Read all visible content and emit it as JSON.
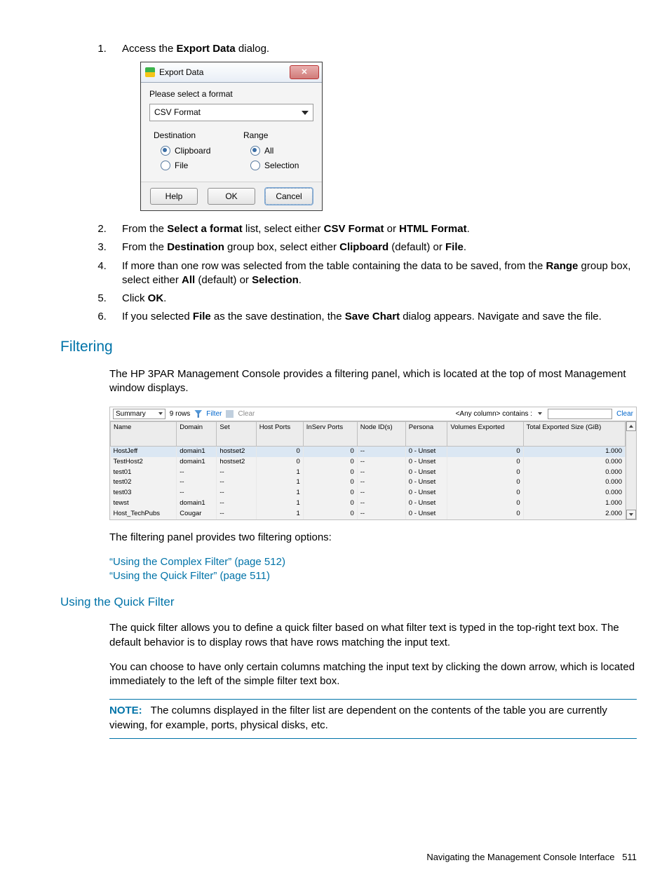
{
  "steps": {
    "s1_pre": "Access the ",
    "s1_b": "Export Data",
    "s1_post": " dialog.",
    "s2_pre": "From the ",
    "s2_b1": "Select a format",
    "s2_mid1": " list, select either ",
    "s2_b2": "CSV Format",
    "s2_mid2": " or ",
    "s2_b3": "HTML Format",
    "s2_post": ".",
    "s3_pre": "From the ",
    "s3_b1": "Destination",
    "s3_mid1": " group box, select either ",
    "s3_b2": "Clipboard",
    "s3_mid2": " (default) or ",
    "s3_b3": "File",
    "s3_post": ".",
    "s4_pre": "If more than one row was selected from the table containing the data to be saved, from the ",
    "s4_b1": "Range",
    "s4_mid1": " group box, select either ",
    "s4_b2": "All",
    "s4_mid2": " (default) or ",
    "s4_b3": "Selection",
    "s4_post": ".",
    "s5_pre": "Click ",
    "s5_b1": "OK",
    "s5_post": ".",
    "s6_pre": "If you selected ",
    "s6_b1": "File",
    "s6_mid1": " as the save destination, the ",
    "s6_b2": "Save Chart",
    "s6_post": " dialog appears. Navigate and save the file."
  },
  "dialog": {
    "title": "Export Data",
    "prompt": "Please select a format",
    "format": "CSV Format",
    "dest_label": "Destination",
    "dest_clip": "Clipboard",
    "dest_file": "File",
    "range_label": "Range",
    "range_all": "All",
    "range_sel": "Selection",
    "help": "Help",
    "ok": "OK",
    "cancel": "Cancel",
    "close_glyph": "✕"
  },
  "filtering": {
    "heading": "Filtering",
    "intro": "The HP 3PAR Management Console provides a filtering panel, which is located at the top of most Management window displays.",
    "after": "The filtering panel provides two filtering options:",
    "link1": "“Using the Complex Filter” (page 512)",
    "link2": "“Using the Quick Filter” (page 511)"
  },
  "quick": {
    "heading": "Using the Quick Filter",
    "p1": "The quick filter allows you to define a quick filter based on what filter text is typed in the top-right text box. The default behavior is to display rows that have rows matching the input text.",
    "p2": "You can choose to have only certain columns matching the input text by clicking the down arrow, which is located immediately to the left of the simple filter text box.",
    "note_label": "NOTE:",
    "note_body": "The columns displayed in the filter list are dependent on the contents of the table you are currently viewing, for example, ports, physical disks, etc."
  },
  "panel": {
    "view": "Summary",
    "rows": "9 rows",
    "filter": "Filter",
    "clear": "Clear",
    "contains": "<Any column> contains :",
    "clear2": "Clear",
    "headers": [
      "Name",
      "Domain",
      "Set",
      "Host Ports",
      "InServ Ports",
      "Node ID(s)",
      "Persona",
      "Volumes Exported",
      "Total Exported Size (GiB)"
    ],
    "rowsData": [
      {
        "n": "HostJeff",
        "d": "domain1",
        "s": "hostset2",
        "hp": "0",
        "ip": "0",
        "ni": "--",
        "p": "0 - Unset",
        "ve": "0",
        "ts": "1.000",
        "sel": true
      },
      {
        "n": "TestHost2",
        "d": "domain1",
        "s": "hostset2",
        "hp": "0",
        "ip": "0",
        "ni": "--",
        "p": "0 - Unset",
        "ve": "0",
        "ts": "0.000"
      },
      {
        "n": "test01",
        "d": "--",
        "s": "--",
        "hp": "1",
        "ip": "0",
        "ni": "--",
        "p": "0 - Unset",
        "ve": "0",
        "ts": "0.000"
      },
      {
        "n": "test02",
        "d": "--",
        "s": "--",
        "hp": "1",
        "ip": "0",
        "ni": "--",
        "p": "0 - Unset",
        "ve": "0",
        "ts": "0.000"
      },
      {
        "n": "test03",
        "d": "--",
        "s": "--",
        "hp": "1",
        "ip": "0",
        "ni": "--",
        "p": "0 - Unset",
        "ve": "0",
        "ts": "0.000"
      },
      {
        "n": "tewst",
        "d": "domain1",
        "s": "--",
        "hp": "1",
        "ip": "0",
        "ni": "--",
        "p": "0 - Unset",
        "ve": "0",
        "ts": "1.000"
      },
      {
        "n": "Host_TechPubs",
        "d": "Cougar",
        "s": "--",
        "hp": "1",
        "ip": "0",
        "ni": "--",
        "p": "0 - Unset",
        "ve": "0",
        "ts": "2.000"
      }
    ]
  },
  "footer": {
    "text": "Navigating the Management Console Interface",
    "page": "511"
  }
}
